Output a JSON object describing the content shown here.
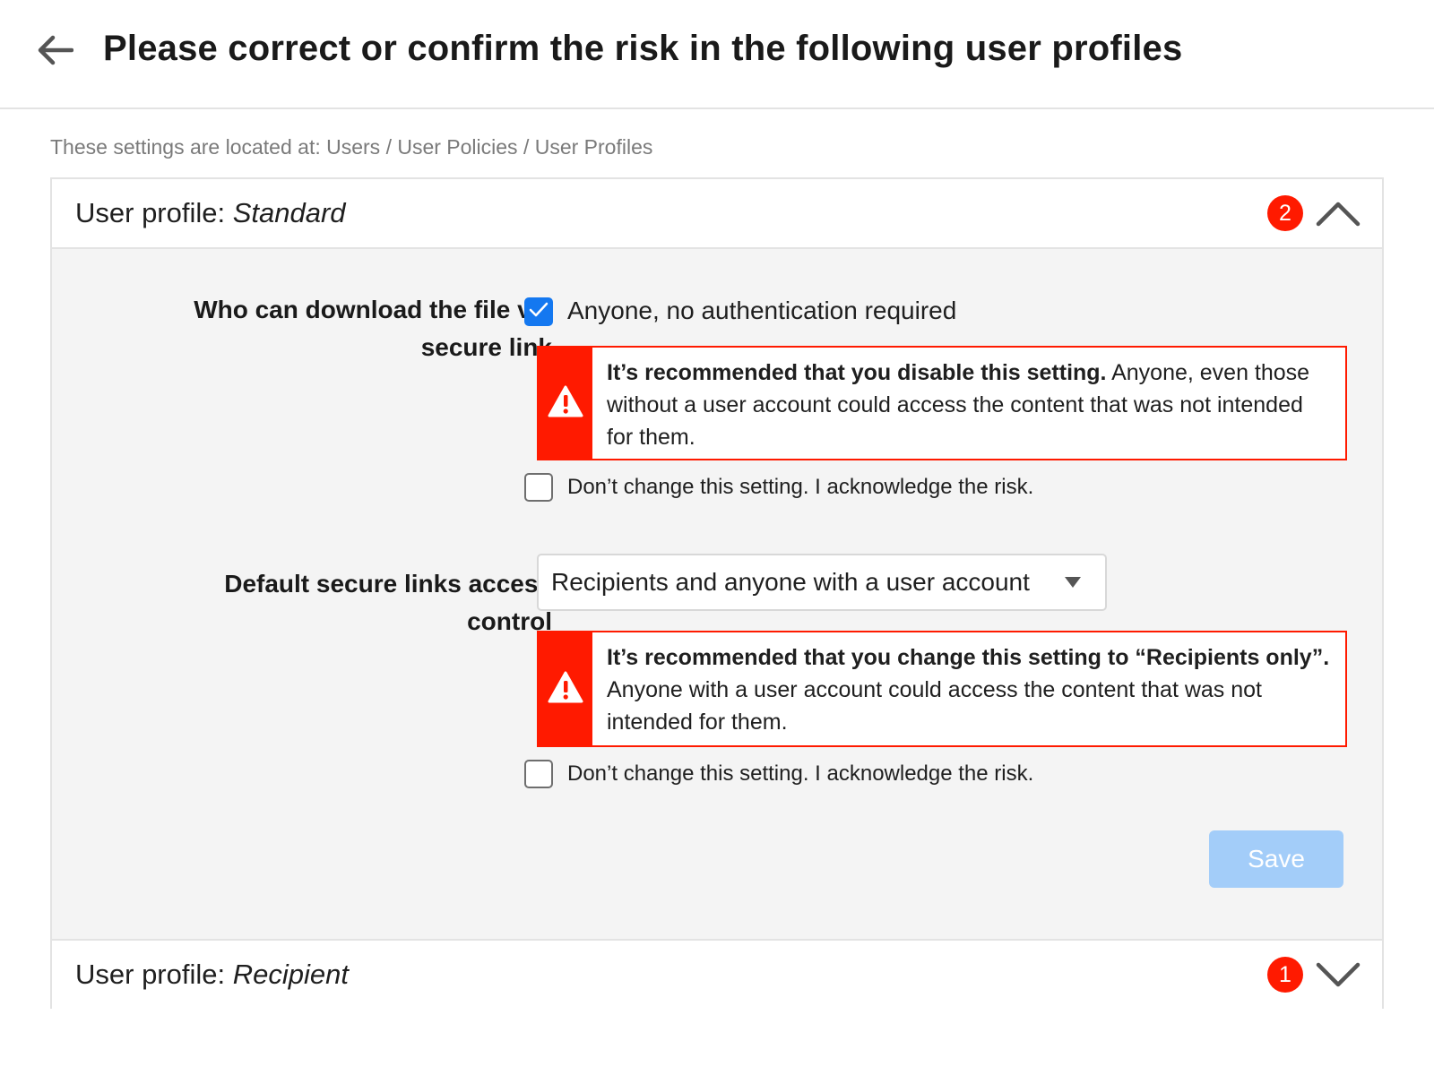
{
  "header": {
    "title": "Please correct or confirm the risk in the following user profiles"
  },
  "location_text": "These settings are located at: Users / User Policies / User Profiles",
  "profiles": [
    {
      "prefix": "User profile: ",
      "name": "Standard",
      "risk_count": "2",
      "expanded": true,
      "settings": [
        {
          "label_line1": "Who can download the file via",
          "label_line2": "secure link",
          "control": "checkbox",
          "checkbox_label": "Anyone, no authentication required",
          "checked": true,
          "warning_bold": "It’s recommended that you disable this setting.",
          "warning_text": " Anyone, even those without a user account could access the content that was not intended for them.",
          "acknowledge_label": "Don’t change this setting. I acknowledge the risk.",
          "acknowledged": false
        },
        {
          "label_line1": "Default secure links access",
          "label_line2": "control",
          "control": "select",
          "selected_value": "Recipients and anyone with a user account",
          "warning_bold": "It’s recommended that you change this setting to “Recipients only”.",
          "warning_text": " Anyone with a user account could access the content that was not intended for them.",
          "acknowledge_label": "Don’t change this setting. I acknowledge the risk.",
          "acknowledged": false
        }
      ],
      "save_label": "Save"
    },
    {
      "prefix": "User profile: ",
      "name": "Recipient",
      "risk_count": "1",
      "expanded": false
    }
  ],
  "colors": {
    "danger": "#ff1a00",
    "primary": "#1478f0",
    "save_disabled": "#a3cdf9"
  },
  "icons": {
    "back": "arrow-left-icon",
    "collapse": "chevron-up-icon",
    "expand": "chevron-down-icon",
    "warning": "warning-triangle-icon",
    "checkmark": "checkmark-icon",
    "dropdown": "caret-down-icon"
  }
}
